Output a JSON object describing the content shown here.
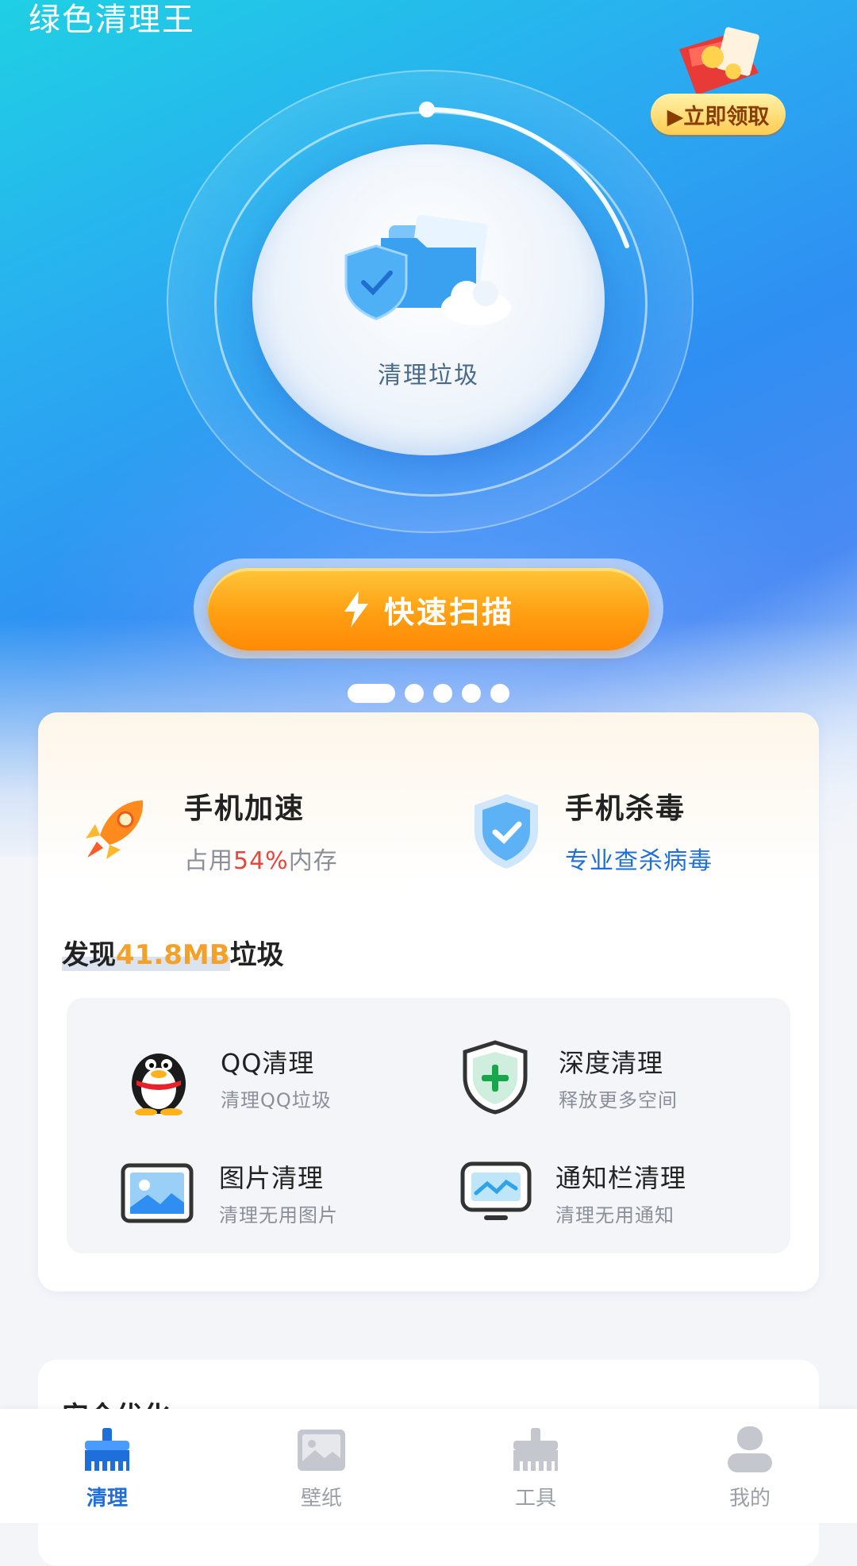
{
  "app": {
    "title": "绿色清理王"
  },
  "promo": {
    "label": "▶立即领取"
  },
  "hero": {
    "center_label": "清理垃圾"
  },
  "scan_button": {
    "label": "快速扫描"
  },
  "carousel": {
    "dot_count": 5,
    "active_index": 0
  },
  "features": [
    {
      "title": "手机加速",
      "sub_prefix": "占用",
      "sub_value": "54%",
      "sub_suffix": "内存",
      "icon": "rocket-icon"
    },
    {
      "title": "手机杀毒",
      "sub": "专业查杀病毒",
      "icon": "shield-check-icon"
    }
  ],
  "junk": {
    "prefix": "发现",
    "value": "41.8MB",
    "suffix": "垃圾"
  },
  "clean_items": [
    {
      "title": "QQ清理",
      "sub": "清理QQ垃圾",
      "icon": "qq-penguin-icon"
    },
    {
      "title": "深度清理",
      "sub": "释放更多空间",
      "icon": "shield-plus-icon"
    },
    {
      "title": "图片清理",
      "sub": "清理无用图片",
      "icon": "picture-icon"
    },
    {
      "title": "通知栏清理",
      "sub": "清理无用通知",
      "icon": "monitor-icon"
    }
  ],
  "section2": {
    "title": "安全优化"
  },
  "tabs": [
    {
      "label": "清理",
      "icon": "broom-icon",
      "active": true
    },
    {
      "label": "壁纸",
      "icon": "wallpaper-icon",
      "active": false
    },
    {
      "label": "工具",
      "icon": "tools-icon",
      "active": false
    },
    {
      "label": "我的",
      "icon": "profile-icon",
      "active": false
    }
  ],
  "colors": {
    "accent_blue": "#1e6fd9",
    "accent_orange": "#ff9f12",
    "highlight_red": "#e8453c",
    "highlight_yellow": "#f3a12b"
  }
}
